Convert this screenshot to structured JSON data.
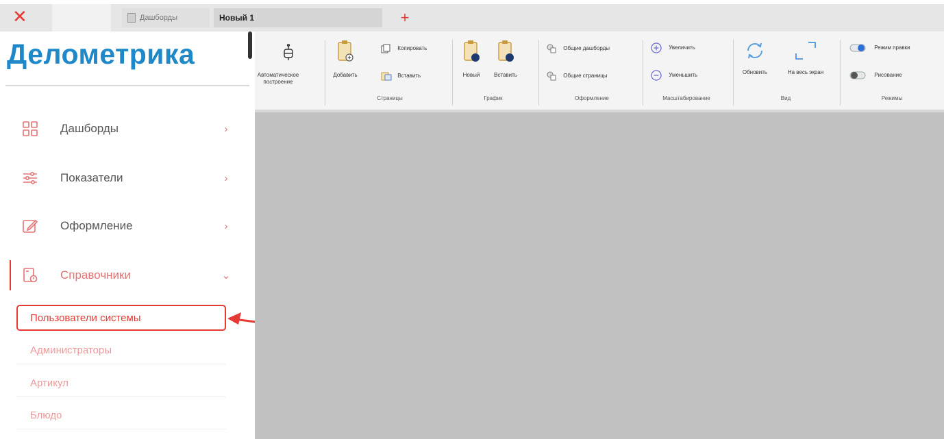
{
  "tabs": {
    "close_glyph": "✕",
    "dashboards_label": "Дашборды",
    "new_label": "Новый 1",
    "add_glyph": "+"
  },
  "sidebar": {
    "logo": "Делометрика",
    "items": [
      {
        "label": "Дашборды",
        "icon": "dashboard-grid-icon",
        "chevron": "›"
      },
      {
        "label": "Показатели",
        "icon": "sliders-icon",
        "chevron": "›"
      },
      {
        "label": "Оформление",
        "icon": "edit-icon",
        "chevron": "›"
      },
      {
        "label": "Справочники",
        "icon": "reference-book-icon",
        "chevron": "⌄"
      }
    ],
    "subitems": [
      {
        "label": "Пользователи системы"
      },
      {
        "label": "Администраторы"
      },
      {
        "label": "Артикул"
      },
      {
        "label": "Блюдо"
      }
    ]
  },
  "ribbon": {
    "auto_build": "Автоматическое построение",
    "pages": {
      "add": "Добавить",
      "copy": "Копировать",
      "paste": "Вставить",
      "group": "Страницы"
    },
    "chart": {
      "new": "Новый",
      "paste": "Вставить",
      "group": "График"
    },
    "design": {
      "common_dashboards": "Общие дашборды",
      "common_pages": "Общие страницы",
      "group": "Оформление"
    },
    "zoom": {
      "in": "Увеличить",
      "out": "Уменьшить",
      "group": "Масштабирование"
    },
    "view": {
      "refresh": "Обновить",
      "fullscreen": "На весь экран",
      "group": "Вид"
    },
    "modes": {
      "edit_mode": "Режим правки",
      "drawing": "Рисование",
      "group": "Режимы"
    }
  },
  "colors": {
    "accent": "#e53935",
    "logo": "#1e88c8",
    "canvas": "#c1c1c1"
  }
}
